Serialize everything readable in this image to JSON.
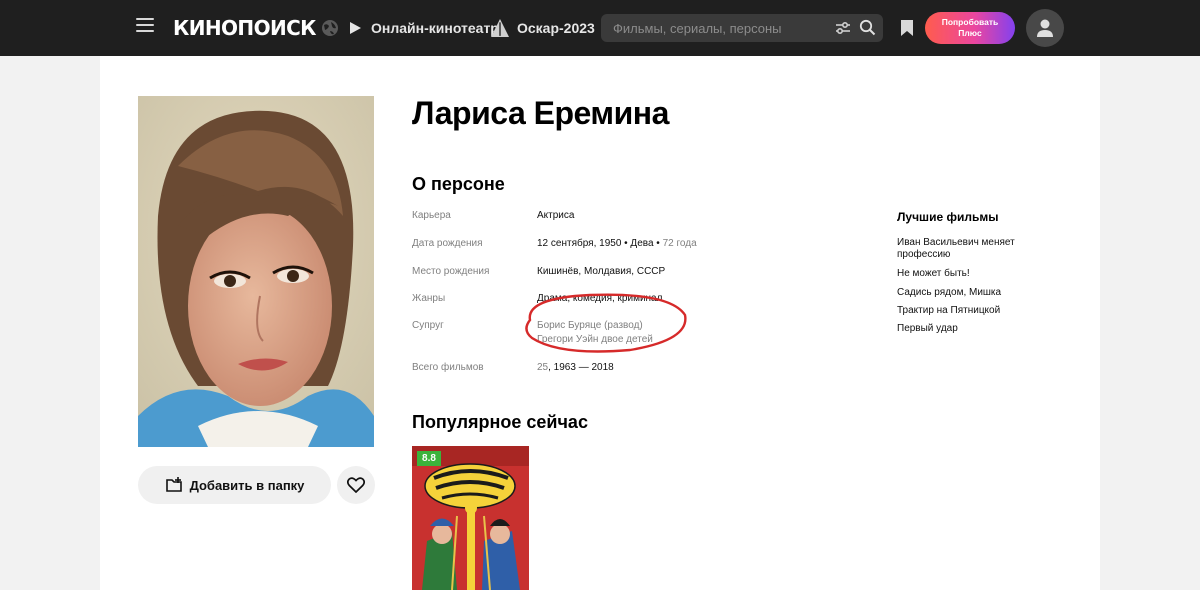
{
  "header": {
    "logo": "КИНОПОИСК",
    "nav": [
      {
        "label": "Онлайн-кинотеатр",
        "icon": "play-icon"
      },
      {
        "label": "Оскар-2023",
        "icon": "oscar-icon"
      }
    ],
    "search_placeholder": "Фильмы, сериалы, персоны",
    "plus_line1": "Попробовать",
    "plus_line2": "Плюс"
  },
  "person": {
    "name": "Лариса Еремина",
    "about_title": "О персоне",
    "info": {
      "career_label": "Карьера",
      "career": "Актриса",
      "birth_label": "Дата рождения",
      "birth_date": "12 сентября, 1950",
      "birth_sign": "• Дева •",
      "age": "72 года",
      "place_label": "Место рождения",
      "place": "Кишинёв, Молдавия, СССР",
      "genres_label": "Жанры",
      "genres": "Драма, комедия, криминал",
      "spouse_label": "Супруг",
      "spouse_1": "Борис Буряце (развод)",
      "spouse_2": "Грегори Уэйн  двое детей",
      "films_label": "Всего фильмов",
      "films_count": "25",
      "films_years": ", 1963 — 2018"
    }
  },
  "actions": {
    "add_folder": "Добавить в папку"
  },
  "popular": {
    "title": "Популярное сейчас",
    "rating": "8.8",
    "rating_color": "#3bb33b"
  },
  "best_films": {
    "title": "Лучшие фильмы",
    "items": [
      "Иван Васильевич меняет профессию",
      "Не может быть!",
      "Садись рядом, Мишка",
      "Трактир на Пятницкой",
      "Первый удар"
    ]
  },
  "colors": {
    "header_bg": "#1f1f1f",
    "highlight": "#d62a2a"
  }
}
